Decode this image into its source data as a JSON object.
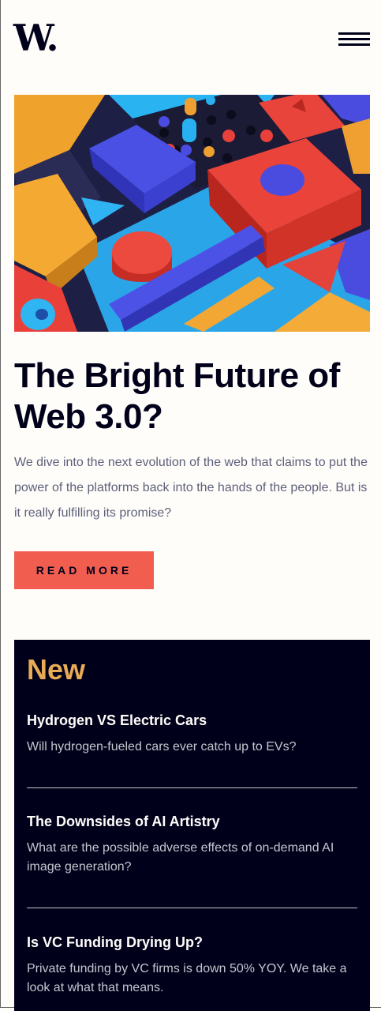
{
  "header": {
    "logo_text": "W.",
    "menu_icon": "hamburger-menu-icon"
  },
  "hero": {
    "image_desc_icon": "abstract-3d-shapes-image",
    "colors": [
      "#f0a030",
      "#e8403a",
      "#4a4ce0",
      "#28b0f0",
      "#1a1d3a"
    ]
  },
  "article": {
    "title": "The Bright Future of Web 3.0?",
    "intro": "We dive into the next evolution of the web that claims to put the power of the platforms back into the hands of the people. But is it really fulfilling its promise?",
    "cta_label": "READ MORE"
  },
  "new_section": {
    "title": "New",
    "items": [
      {
        "title": "Hydrogen VS Electric Cars",
        "summary": "Will hydrogen-fueled cars ever catch up to EVs?"
      },
      {
        "title": "The Downsides of AI Artistry",
        "summary": "What are the possible adverse effects of on-demand AI image generation?"
      },
      {
        "title": "Is VC Funding Drying Up?",
        "summary": "Private funding by VC firms is down 50% YOY. We take a look at what that means."
      }
    ]
  },
  "colors": {
    "background": "#fffdfa",
    "dark_navy": "#00001a",
    "accent_red": "#f15e50",
    "accent_orange": "#e9ab53",
    "muted_text": "#5d5f79"
  }
}
